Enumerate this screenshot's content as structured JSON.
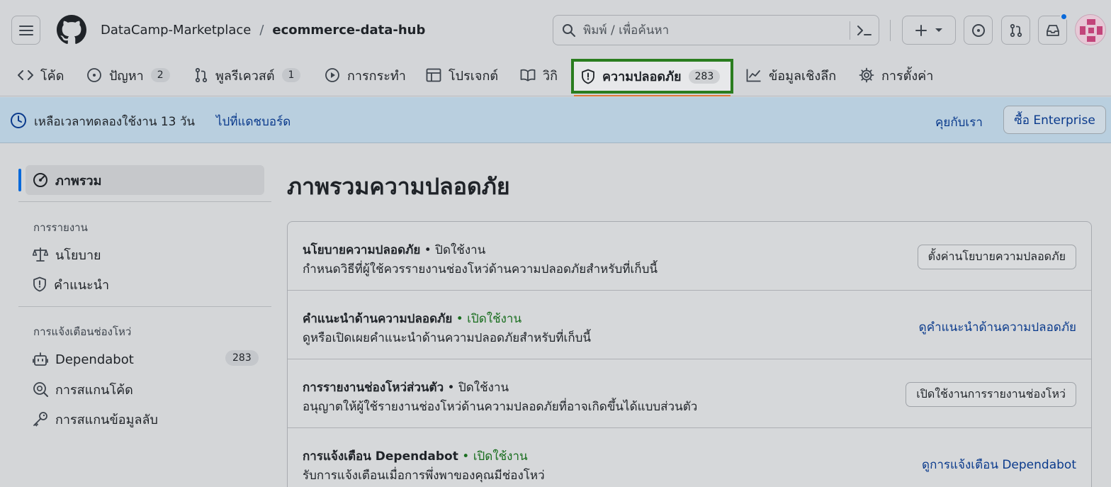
{
  "header": {
    "owner": "DataCamp-Marketplace",
    "separator": "/",
    "repo": "ecommerce-data-hub",
    "search_placeholder": "พิมพ์ / เพื่อค้นหา"
  },
  "tabs": [
    {
      "label": "โค้ด",
      "icon": "code-icon"
    },
    {
      "label": "ปัญหา",
      "count": "2",
      "icon": "issue-icon"
    },
    {
      "label": "พูลรีเควสต์",
      "count": "1",
      "icon": "pull-request-icon"
    },
    {
      "label": "การกระทำ",
      "icon": "play-icon"
    },
    {
      "label": "โปรเจกต์",
      "icon": "table-icon"
    },
    {
      "label": "วิกิ",
      "icon": "book-icon"
    },
    {
      "label": "ความปลอดภัย",
      "count": "283",
      "icon": "shield-icon",
      "active": true
    },
    {
      "label": "ข้อมูลเชิงลึก",
      "icon": "graph-icon"
    },
    {
      "label": "การตั้งค่า",
      "icon": "gear-icon"
    }
  ],
  "banner": {
    "trial_text": "เหลือเวลาทดลองใช้งาน 13 วัน",
    "dashboard_link": "ไปที่แดชบอร์ด",
    "contact_link": "คุยกับเรา",
    "buy_button": "ซื้อ Enterprise"
  },
  "sidebar": {
    "overview": "ภาพรวม",
    "reporting_heading": "การรายงาน",
    "policy": "นโยบาย",
    "advisories": "คำแนะนำ",
    "alerts_heading": "การแจ้งเตือนช่องโหว่",
    "dependabot": "Dependabot",
    "dependabot_count": "283",
    "code_scanning": "การสแกนโค้ด",
    "secret_scanning": "การสแกนข้อมูลลับ"
  },
  "main": {
    "title": "ภาพรวมความปลอดภัย",
    "rows": [
      {
        "title": "นโยบายความปลอดภัย",
        "status": "• ปิดใช้งาน",
        "desc": "กำหนดวิธีที่ผู้ใช้ควรรายงานช่องโหว่ด้านความปลอดภัยสำหรับที่เก็บนี้",
        "action": "ตั้งค่านโยบายความปลอดภัย"
      },
      {
        "title": "คำแนะนำด้านความปลอดภัย",
        "status": "• เปิดใช้งาน",
        "desc": "ดูหรือเปิดเผยคำแนะนำด้านความปลอดภัยสำหรับที่เก็บนี้",
        "action": "ดูคำแนะนำด้านความปลอดภัย"
      },
      {
        "title": "การรายงานช่องโหว่ส่วนตัว",
        "status": "• ปิดใช้งาน",
        "desc": "อนุญาตให้ผู้ใช้รายงานช่องโหว่ด้านความปลอดภัยที่อาจเกิดขึ้นได้แบบส่วนตัว",
        "action": "เปิดใช้งานการรายงานช่องโหว่"
      },
      {
        "title": "การแจ้งเตือน Dependabot",
        "status": "• เปิดใช้งาน",
        "desc": "รับการแจ้งเตือนเมื่อการพึ่งพาของคุณมีช่องโหว่",
        "action": "ดูการแจ้งเตือน Dependabot"
      }
    ]
  },
  "colors": {
    "active_outline": "#2a7d1f",
    "status_on": "#1a6e1f",
    "link": "#0a3a8c",
    "banner": "#b9cfdf"
  }
}
